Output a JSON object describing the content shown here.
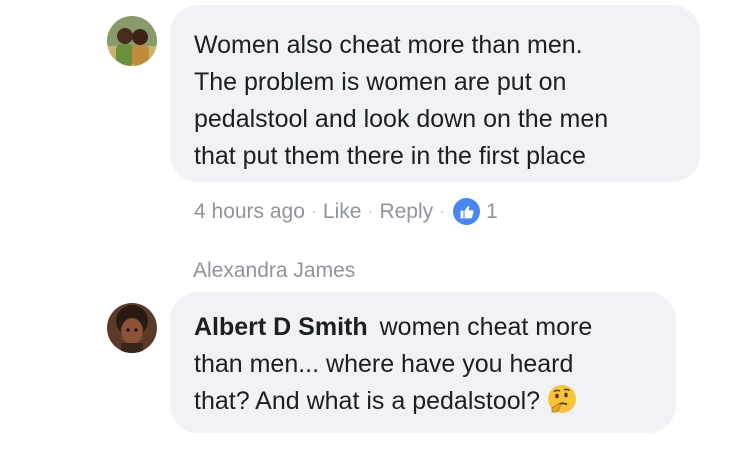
{
  "comment1": {
    "lines": [
      "Women also cheat more than men.",
      "The problem is women are put on",
      "pedalstool and look down on the men",
      "that put them there in the first place"
    ],
    "time": "4 hours ago",
    "like_label": "Like",
    "reply_label": "Reply",
    "separator": "·",
    "reaction_count": "1",
    "reaction_icon": "thumbs-up-icon"
  },
  "reply_context": {
    "replying_to": "Alexandra James"
  },
  "comment2": {
    "author": "Albert D Smith",
    "line1_text": "women cheat more",
    "line2": "than men... where have you heard",
    "line3": "that? And what is a pedalstool?",
    "emoji": "thinking-face-emoji"
  },
  "colors": {
    "bubble_bg": "#f0f2f5",
    "meta_text": "#90949c",
    "like_blue": "#4a86f0",
    "text": "#1c1e21"
  }
}
